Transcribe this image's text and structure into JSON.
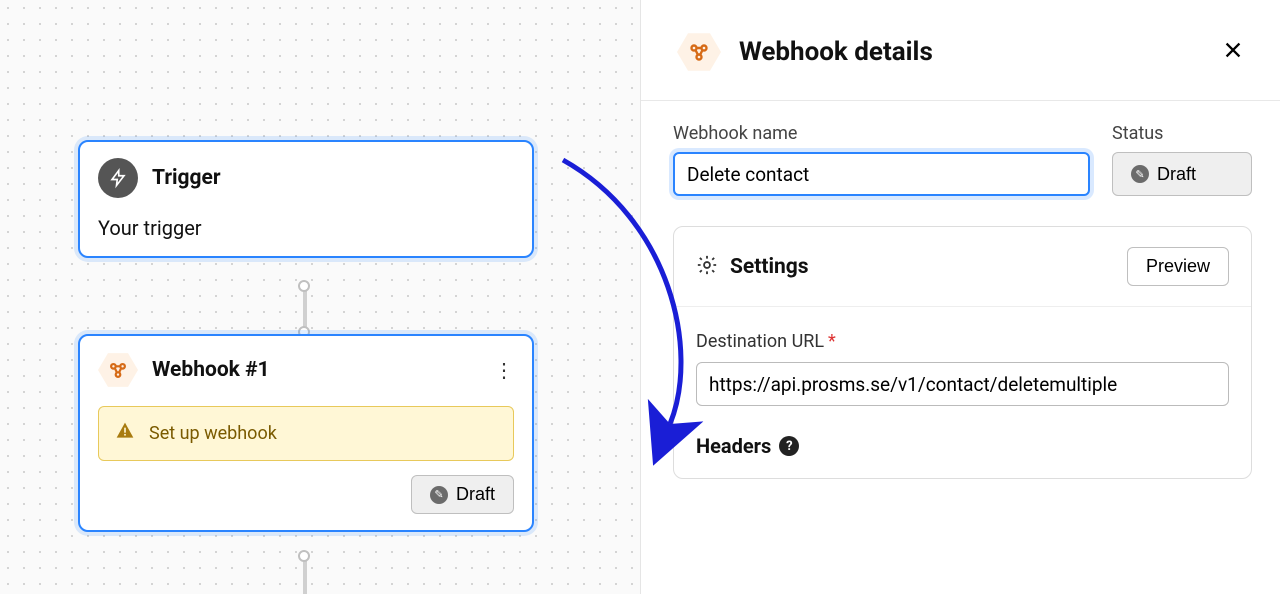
{
  "left": {
    "trigger": {
      "title": "Trigger",
      "subtitle": "Your trigger"
    },
    "webhook": {
      "title": "Webhook #1",
      "banner": "Set up webhook",
      "status": "Draft"
    }
  },
  "panel": {
    "title": "Webhook details",
    "name_label": "Webhook name",
    "name_value": "Delete contact",
    "status_label": "Status",
    "status_value": "Draft",
    "settings_title": "Settings",
    "preview_label": "Preview",
    "dest_label": "Destination URL",
    "dest_value": "https://api.prosms.se/v1/contact/deletemultiple",
    "headers_label": "Headers"
  }
}
